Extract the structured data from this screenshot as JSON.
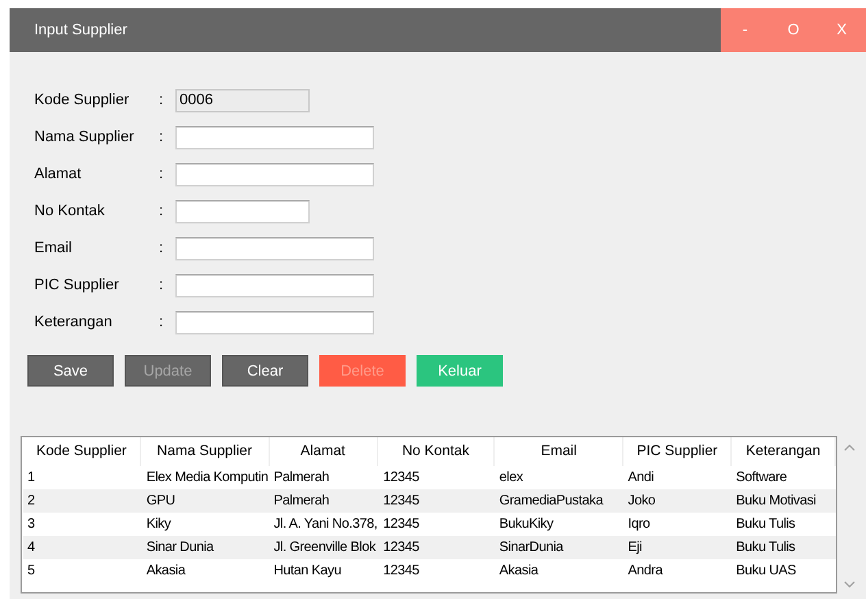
{
  "window": {
    "title": "Input Supplier",
    "controls": [
      "-",
      "O",
      "X"
    ]
  },
  "form": {
    "separator": ":",
    "fields": [
      {
        "label": "Kode Supplier",
        "value": "0006",
        "disabled": true
      },
      {
        "label": "Nama Supplier",
        "disabled": false
      },
      {
        "label": "Alamat",
        "disabled": false
      },
      {
        "label": "No Kontak",
        "disabled": false
      },
      {
        "label": "Email",
        "disabled": false
      },
      {
        "label": "PIC Supplier",
        "disabled": false
      },
      {
        "label": "Keterangan",
        "disabled": false
      }
    ]
  },
  "buttons": [
    {
      "label": "Save",
      "kind": "neutral",
      "disabled": false
    },
    {
      "label": "Update",
      "kind": "neutral",
      "disabled": true
    },
    {
      "label": "Clear",
      "kind": "neutral",
      "disabled": false
    },
    {
      "label": "Delete",
      "kind": "danger",
      "disabled": true
    },
    {
      "label": "Keluar",
      "kind": "success",
      "disabled": false
    }
  ],
  "table": {
    "columns": [
      "Kode Supplier",
      "Nama Supplier",
      "Alamat",
      "No Kontak",
      "Email",
      "PIC Supplier",
      "Keterangan"
    ],
    "rows": [
      [
        "1",
        "Elex Media Komputin",
        "Palmerah",
        "12345",
        "elex",
        "Andi",
        "Software"
      ],
      [
        "2",
        "GPU",
        "Palmerah",
        "12345",
        "GramediaPustaka",
        "Joko",
        "Buku Motivasi"
      ],
      [
        "3",
        "Kiky",
        "Jl. A. Yani No.378,",
        "12345",
        "BukuKiky",
        "Iqro",
        "Buku Tulis"
      ],
      [
        "4",
        "Sinar Dunia",
        "Jl. Greenville Blok",
        "12345",
        "SinarDunia",
        "Eji",
        "Buku Tulis"
      ],
      [
        "5",
        "Akasia",
        "Hutan Kayu",
        "12345",
        "Akasia",
        "Andra",
        "Buku UAS"
      ]
    ]
  }
}
